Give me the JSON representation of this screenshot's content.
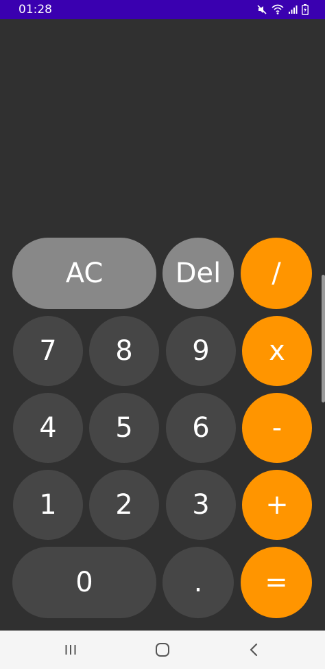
{
  "status_bar": {
    "time": "01:28",
    "icons": [
      "mute-icon",
      "wifi-icon",
      "signal-icon",
      "battery-charging-icon"
    ],
    "background": "#3a00b0"
  },
  "display": {
    "value": ""
  },
  "keys": {
    "ac": "AC",
    "del": "Del",
    "divide": "/",
    "seven": "7",
    "eight": "8",
    "nine": "9",
    "multiply": "x",
    "four": "4",
    "five": "5",
    "six": "6",
    "minus": "-",
    "one": "1",
    "two": "2",
    "three": "3",
    "plus": "+",
    "zero": "0",
    "dot": ".",
    "equals": "="
  },
  "colors": {
    "background": "#303030",
    "function_key": "#888888",
    "number_key": "#464646",
    "operator_key": "#ff9500",
    "nav_bar": "#f5f5f5"
  },
  "nav_bar": {
    "icons": [
      "recent-apps-icon",
      "home-icon",
      "back-icon"
    ]
  }
}
